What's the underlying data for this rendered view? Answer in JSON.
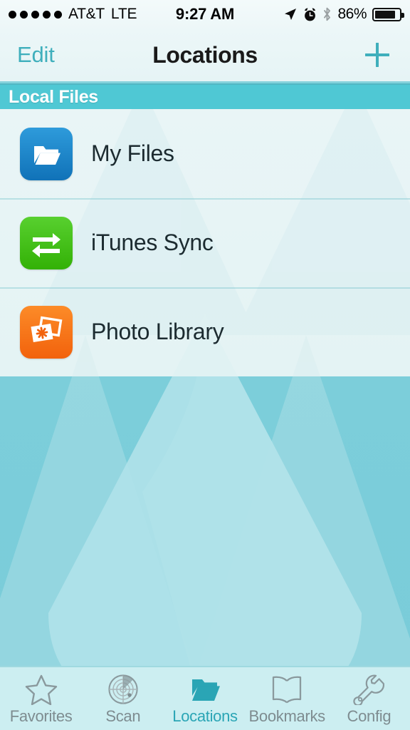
{
  "statusbar": {
    "signal_dots": 5,
    "carrier": "AT&T",
    "network": "LTE",
    "time": "9:27 AM",
    "battery_percent": "86%",
    "battery_level": 86,
    "icons": [
      "location-arrow-icon",
      "alarm-clock-icon",
      "bluetooth-icon"
    ]
  },
  "navbar": {
    "edit_label": "Edit",
    "title": "Locations",
    "add_icon": "plus-icon",
    "accent_color": "#3FAFBC"
  },
  "section": {
    "header_label": "Local Files",
    "header_bg": "#4FC8D4"
  },
  "list": {
    "rows": [
      {
        "label": "My Files",
        "icon": "folder-icon",
        "icon_color": "#1E86C8"
      },
      {
        "label": "iTunes Sync",
        "icon": "sync-arrows-icon",
        "icon_color": "#44C01B"
      },
      {
        "label": "Photo Library",
        "icon": "photos-icon",
        "icon_color": "#F7741A"
      }
    ]
  },
  "tabbar": {
    "active_index": 2,
    "active_color": "#2AA5B5",
    "inactive_color": "#7E8C90",
    "tabs": [
      {
        "label": "Favorites",
        "icon": "star-icon"
      },
      {
        "label": "Scan",
        "icon": "radar-icon"
      },
      {
        "label": "Locations",
        "icon": "folder-icon"
      },
      {
        "label": "Bookmarks",
        "icon": "book-icon"
      },
      {
        "label": "Config",
        "icon": "wrench-icon"
      }
    ]
  },
  "background": {
    "watermark": "water-drop-logo",
    "base_color": "#7CCEDA",
    "drop_color": "#A5DDE4"
  }
}
